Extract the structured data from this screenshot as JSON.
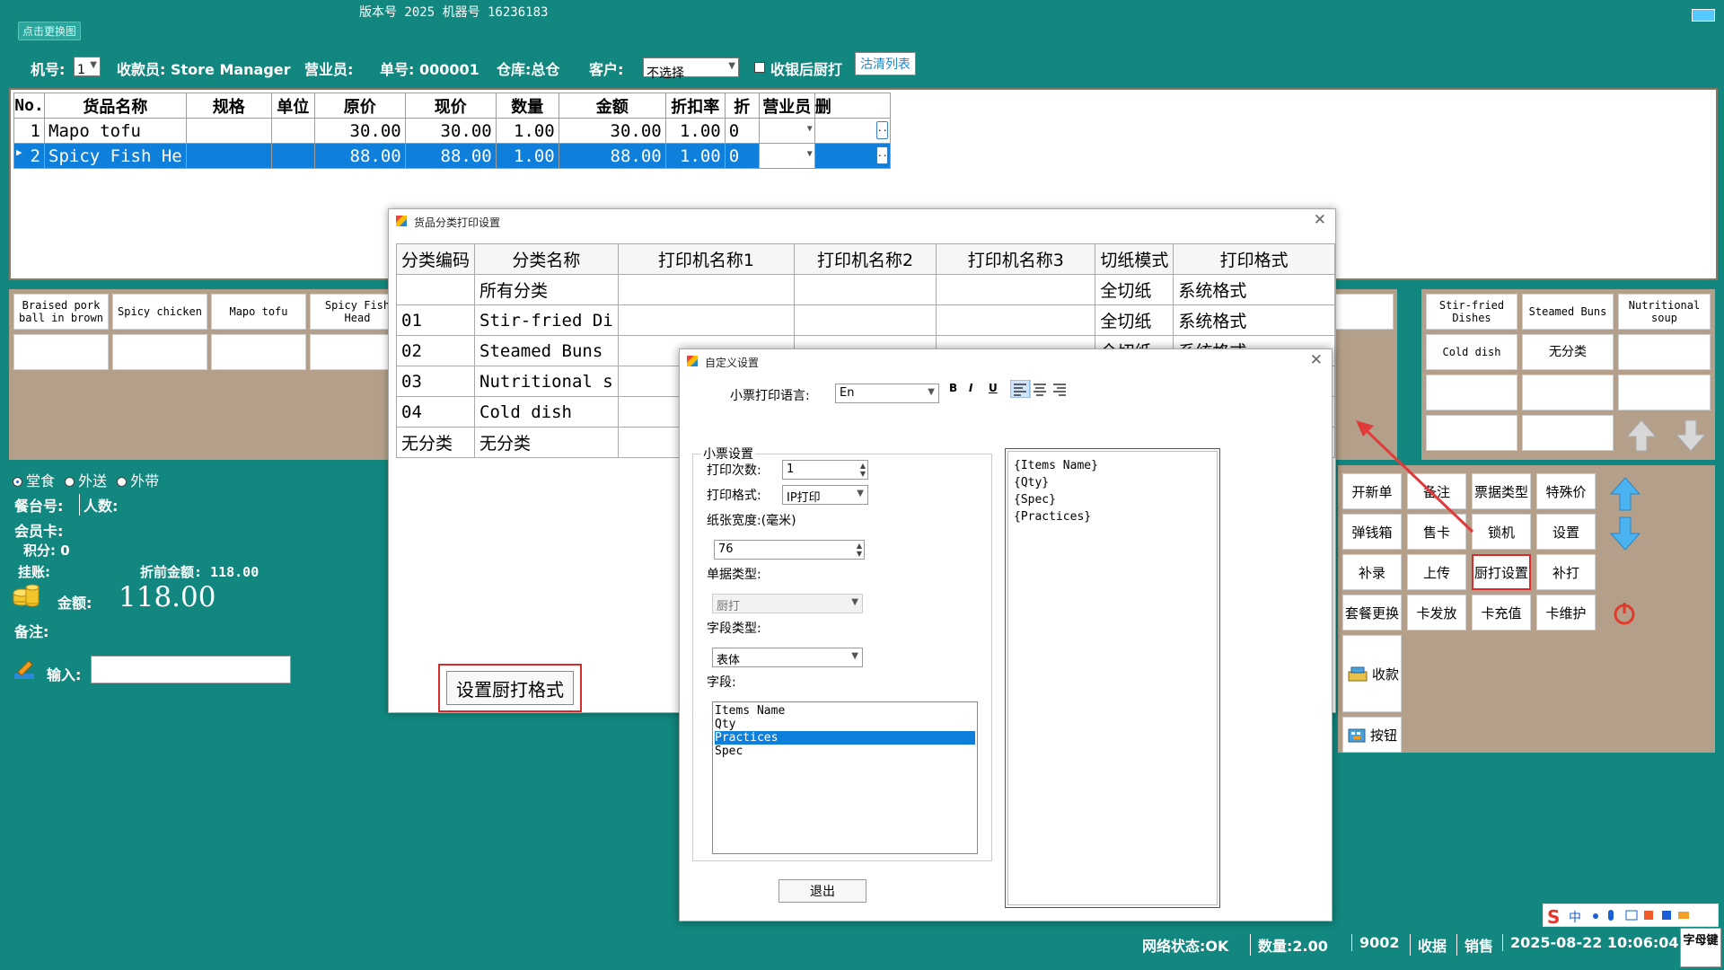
{
  "top": {
    "logo_text": "点击更换图",
    "version": "版本号  2025  机器号  16236183"
  },
  "info": {
    "machine_label": "机号:",
    "machine_value": "1",
    "cashier": "收款员: Store Manager",
    "salesman": "营业员:",
    "order": "单号: 000001",
    "warehouse": "仓库:总仓",
    "customer_label": "客户:",
    "customer_value": "不选择",
    "kitchen_after_checkout": "收银后厨打",
    "clear_list": "沽清列表"
  },
  "grid": {
    "headers": [
      "No.",
      "货品名称",
      "规格",
      "单位",
      "原价",
      "现价",
      "数量",
      "金额",
      "折扣率",
      "折",
      "营业员",
      "删"
    ],
    "rows": [
      {
        "no": "1",
        "name": "Mapo tofu",
        "spec": "",
        "unit": "",
        "orig": "30.00",
        "price": "30.00",
        "qty": "1.00",
        "amount": "30.00",
        "rate": "1.00",
        "disc": "0",
        "sales": ""
      },
      {
        "no": "2",
        "name": "Spicy Fish He",
        "spec": "",
        "unit": "",
        "orig": "88.00",
        "price": "88.00",
        "qty": "1.00",
        "amount": "88.00",
        "rate": "1.00",
        "disc": "0",
        "sales": ""
      }
    ]
  },
  "products": [
    "Braised pork ball in brown",
    "Spicy chicken",
    "Mapo tofu",
    "Spicy Fish Head"
  ],
  "categories": [
    "Stir-fried Dishes",
    "Steamed Buns",
    "Nutritional soup",
    "Cold dish",
    "无分类"
  ],
  "left": {
    "dine_in": "堂食",
    "delivery": "外送",
    "takeaway": "外带",
    "table_no": "餐台号:",
    "people": "人数:",
    "member_card": "会员卡:",
    "points": "积分: 0",
    "credit": "挂账:",
    "before_discount": "折前金额: 118.00",
    "amount_label": "金额:",
    "amount_value": "118.00",
    "remark": "备注:",
    "input_label": "输入:"
  },
  "buttons": {
    "row1": [
      "开新单",
      "备注",
      "票据类型",
      "特殊价"
    ],
    "row2": [
      "弹钱箱",
      "售卡",
      "锁机",
      "设置"
    ],
    "row3": [
      "补录",
      "上传",
      "厨打设置",
      "补打"
    ],
    "row4": [
      "套餐更换",
      "卡发放",
      "卡充值",
      "卡维护"
    ],
    "checkout": "收款",
    "keys": "按钮"
  },
  "status": {
    "network": "网络状态:OK",
    "quantity": "数量:2.00",
    "code": "9002",
    "collect": "收据",
    "sale": "销售",
    "datetime": "2025-08-22 10:06:04",
    "ime_corner": "字母键"
  },
  "dialog1": {
    "title": "货品分类打印设置",
    "headers": [
      "分类编码",
      "分类名称",
      "打印机名称1",
      "打印机名称2",
      "打印机名称3",
      "切纸模式",
      "打印格式"
    ],
    "rows": [
      {
        "code": "",
        "name": "所有分类",
        "cut": "全切纸",
        "fmt": "系统格式"
      },
      {
        "code": "01",
        "name": "Stir-fried Di",
        "cut": "全切纸",
        "fmt": "系统格式"
      },
      {
        "code": "02",
        "name": "Steamed Buns",
        "cut": "全切纸",
        "fmt": "系统格式"
      },
      {
        "code": "03",
        "name": "Nutritional s",
        "cut": "",
        "fmt": ""
      },
      {
        "code": "04",
        "name": "Cold dish",
        "cut": "",
        "fmt": ""
      },
      {
        "code": "无分类",
        "name": "无分类",
        "cut": "",
        "fmt": ""
      }
    ],
    "set_format_button": "设置厨打格式"
  },
  "dialog2": {
    "title": "自定义设置",
    "language_label": "小票打印语言:",
    "language_value": "En",
    "group_title": "小票设置",
    "print_times_label": "打印次数:",
    "print_times_value": "1",
    "print_format_label": "打印格式:",
    "print_format_value": "IP打印",
    "paper_width_label": "纸张宽度:(毫米)",
    "paper_width_value": "76",
    "doc_type_label": "单据类型:",
    "doc_type_value": "厨打",
    "field_type_label": "字段类型:",
    "field_type_value": "表体",
    "fields_label": "字段:",
    "fields": [
      "Items Name",
      "Qty",
      "Practices",
      "Spec"
    ],
    "selected_field": "Practices",
    "preview_lines": [
      "{Items Name}",
      "{Qty}",
      "{Spec}",
      "{Practices}"
    ],
    "exit_button": "退出",
    "fmt_bold": "B",
    "fmt_italic": "I",
    "fmt_underline": "U"
  }
}
